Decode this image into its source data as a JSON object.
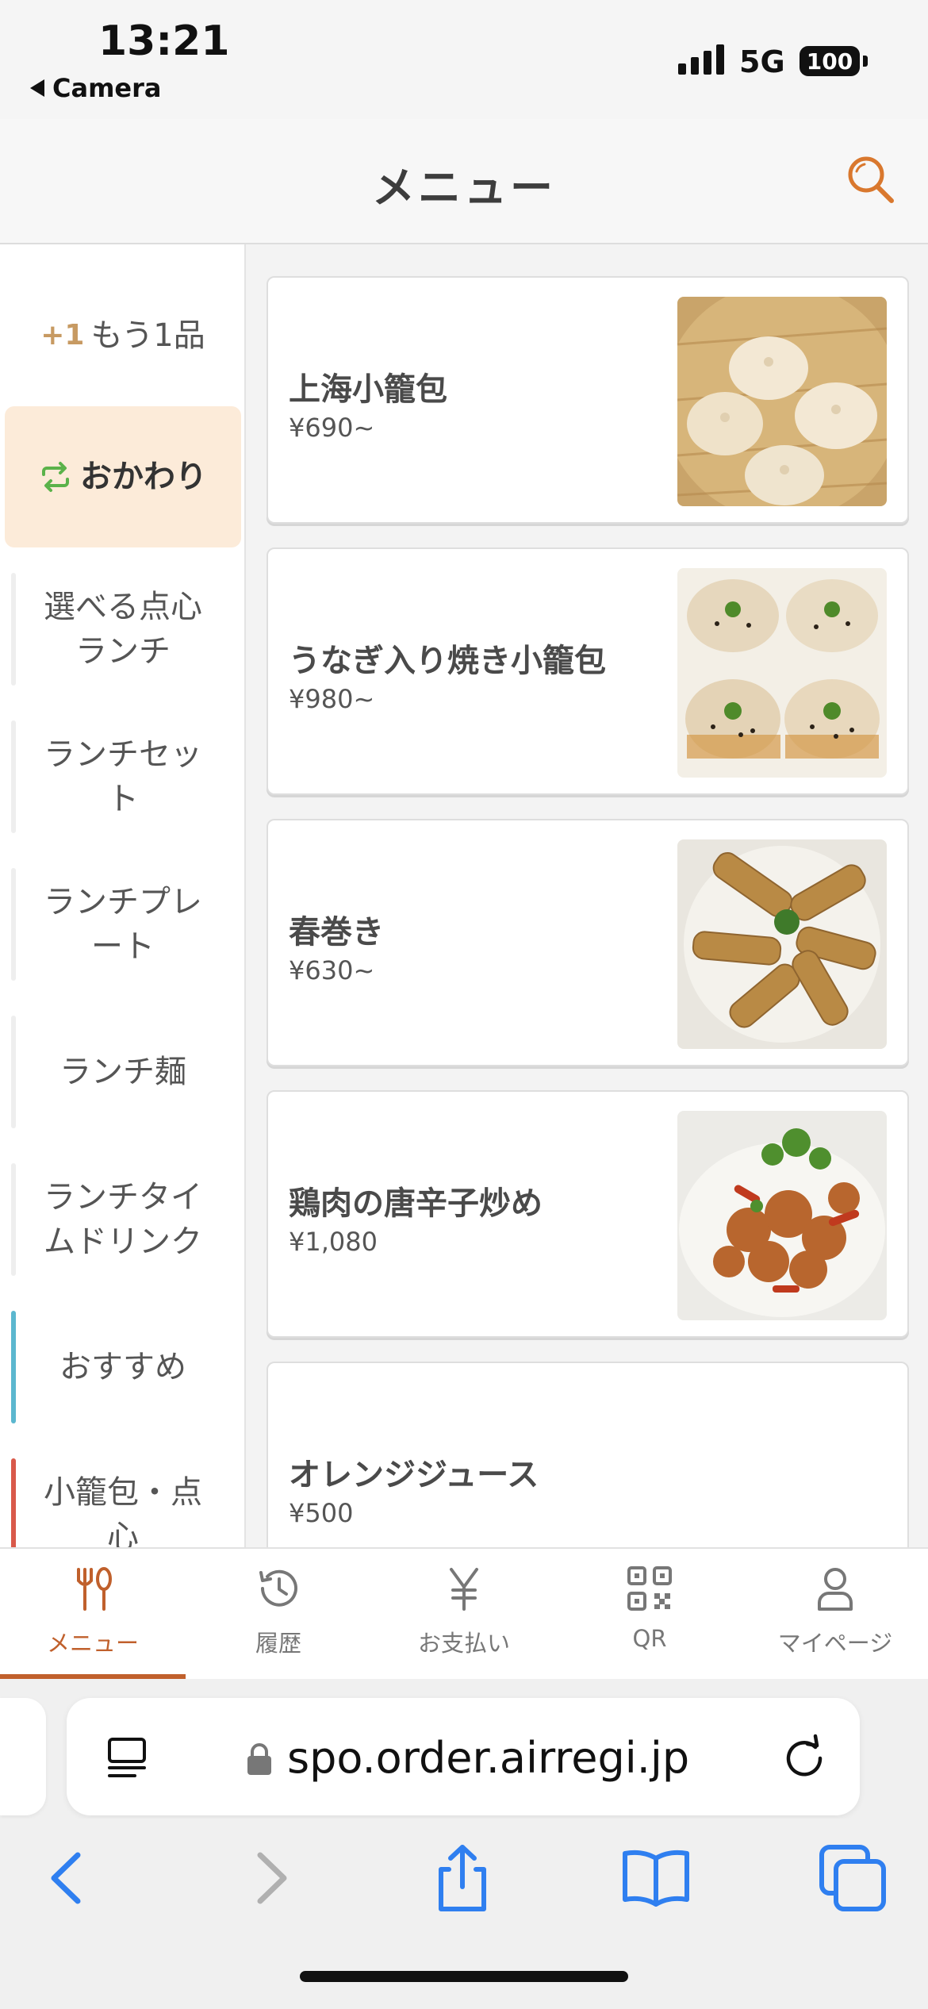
{
  "status_bar": {
    "time": "13:21",
    "back_app": "Camera",
    "network": "5G",
    "battery": "100"
  },
  "header": {
    "title": "メニュー",
    "search_icon": "search-icon",
    "accent_color": "#d9782e"
  },
  "sidebar": {
    "items": [
      {
        "prefix": "+1",
        "label": "もう1品"
      },
      {
        "label": "おかわり",
        "icon": "refresh-icon",
        "active": true
      },
      {
        "label": "選べる点心ランチ"
      },
      {
        "label": "ランチセット"
      },
      {
        "label": "ランチプレート"
      },
      {
        "label": "ランチ麺"
      },
      {
        "label": "ランチタイムドリンク"
      },
      {
        "label": "おすすめ",
        "bar_color": "#5bb7cf"
      },
      {
        "label": "小籠包・点心",
        "bar_color": "#d9594a"
      }
    ]
  },
  "menu_items": [
    {
      "name": "上海小籠包",
      "price": "¥690~",
      "image": "xiaolongbao-photo"
    },
    {
      "name": "うなぎ入り焼き小籠包",
      "price": "¥980~",
      "image": "pan-fried-bao-photo"
    },
    {
      "name": "春巻き",
      "price": "¥630~",
      "image": "spring-rolls-photo"
    },
    {
      "name": "鶏肉の唐辛子炒め",
      "price": "¥1,080",
      "image": "chili-chicken-photo"
    },
    {
      "name": "オレンジジュース",
      "price": "¥500"
    }
  ],
  "tabbar": {
    "tabs": [
      {
        "label": "メニュー",
        "icon": "fork-knife-icon",
        "active": true
      },
      {
        "label": "履歴",
        "icon": "history-icon"
      },
      {
        "label": "お支払い",
        "icon": "yen-icon"
      },
      {
        "label": "QR",
        "icon": "qr-code-icon"
      },
      {
        "label": "マイページ",
        "icon": "person-icon"
      }
    ],
    "active_color": "#c0602c"
  },
  "browser": {
    "url": "spo.order.airregi.jp",
    "icons": [
      "reader-icon",
      "lock-icon",
      "reload-icon",
      "back-icon",
      "forward-icon",
      "share-icon",
      "bookmarks-icon",
      "tabs-icon"
    ],
    "accent_color": "#2f7ff0"
  }
}
